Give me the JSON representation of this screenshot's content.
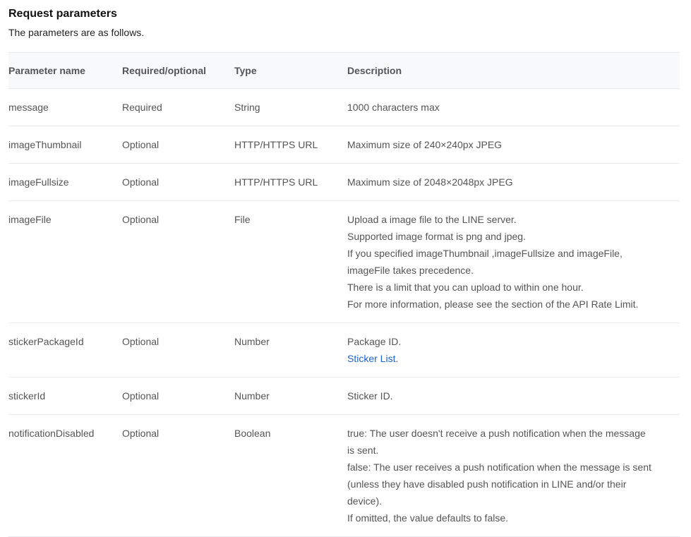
{
  "section": {
    "title": "Request parameters",
    "subtitle": "The parameters are as follows."
  },
  "table": {
    "headers": {
      "name": "Parameter name",
      "required": "Required/optional",
      "type": "Type",
      "description": "Description"
    },
    "rows": [
      {
        "name": "message",
        "required": "Required",
        "type": "String",
        "description": [
          "1000 characters max"
        ]
      },
      {
        "name": "imageThumbnail",
        "required": "Optional",
        "type": "HTTP/HTTPS URL",
        "description": [
          "Maximum size of 240×240px JPEG"
        ]
      },
      {
        "name": "imageFullsize",
        "required": "Optional",
        "type": "HTTP/HTTPS URL",
        "description": [
          "Maximum size of 2048×2048px JPEG"
        ]
      },
      {
        "name": "imageFile",
        "required": "Optional",
        "type": "File",
        "description": [
          "Upload a image file to the LINE server.",
          "Supported image format is png and jpeg.",
          "If you specified imageThumbnail ,imageFullsize and imageFile, imageFile takes precedence.",
          "There is a limit that you can upload to within one hour.",
          "For more information, please see the section of the API Rate Limit."
        ]
      },
      {
        "name": "stickerPackageId",
        "required": "Optional",
        "type": "Number",
        "description": [
          "Package ID."
        ],
        "link": {
          "text": "Sticker List",
          "suffix": "."
        }
      },
      {
        "name": "stickerId",
        "required": "Optional",
        "type": "Number",
        "description": [
          "Sticker ID."
        ]
      },
      {
        "name": "notificationDisabled",
        "required": "Optional",
        "type": "Boolean",
        "description": [
          "true: The user doesn't receive a push notification when the message is sent.",
          "false: The user receives a push notification when the message is sent (unless they have disabled push notification in LINE and/or their device).",
          "If omitted, the value defaults to false."
        ]
      }
    ]
  },
  "colors": {
    "link": "#1a63d3",
    "header_bg": "#f8f9fb",
    "border": "#e8eaee"
  }
}
